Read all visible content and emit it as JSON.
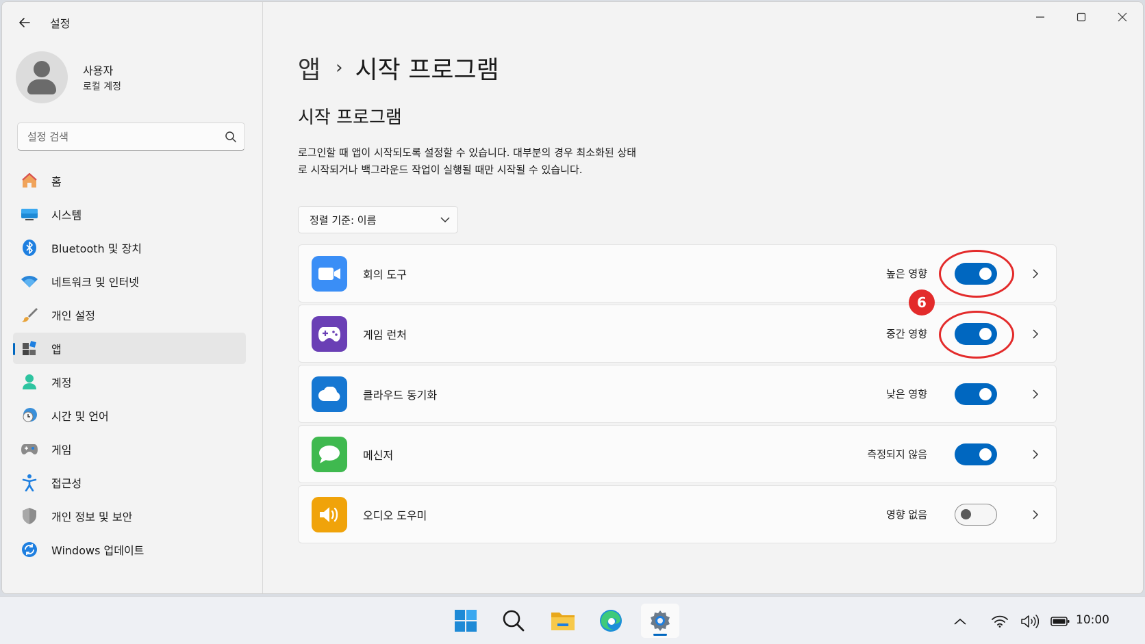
{
  "window": {
    "app_title": "설정",
    "controls": {
      "minimize": "─",
      "maximize": "☐",
      "close": "✕"
    }
  },
  "profile": {
    "name": "사용자",
    "account_type": "로컬 계정"
  },
  "search": {
    "placeholder": "설정 검색"
  },
  "sidebar": {
    "items": [
      {
        "label": "홈",
        "icon": "home-icon"
      },
      {
        "label": "시스템",
        "icon": "system-icon"
      },
      {
        "label": "Bluetooth 및 장치",
        "icon": "bluetooth-icon"
      },
      {
        "label": "네트워크 및 인터넷",
        "icon": "wifi-icon"
      },
      {
        "label": "개인 설정",
        "icon": "brush-icon"
      },
      {
        "label": "앱",
        "icon": "apps-icon",
        "active": true
      },
      {
        "label": "계정",
        "icon": "account-icon"
      },
      {
        "label": "시간 및 언어",
        "icon": "clock-globe-icon"
      },
      {
        "label": "게임",
        "icon": "gamepad-icon"
      },
      {
        "label": "접근성",
        "icon": "accessibility-icon"
      },
      {
        "label": "개인 정보 및 보안",
        "icon": "shield-icon"
      },
      {
        "label": "Windows 업데이트",
        "icon": "update-icon"
      }
    ]
  },
  "main": {
    "breadcrumb": {
      "parent": "앱",
      "separator": "›",
      "current": "시작 프로그램"
    },
    "section_title": "시작 프로그램",
    "description": "로그인할 때 앱이 시작되도록 설정할 수 있습니다. 대부분의 경우 최소화된 상태로 시작되거나 백그라운드 작업이 실행될 때만 시작될 수 있습니다.",
    "sort": {
      "label": "정렬 기준: 이름"
    },
    "apps": [
      {
        "name": "회의 도구",
        "impact": "높은 영향",
        "enabled": true,
        "icon": "video-camera-icon",
        "color": "#3a8ef6"
      },
      {
        "name": "게임 런처",
        "impact": "중간 영향",
        "enabled": true,
        "icon": "game-controller-icon",
        "color": "#6a3fb5"
      },
      {
        "name": "클라우드 동기화",
        "impact": "낮은 영향",
        "enabled": true,
        "icon": "cloud-icon",
        "color": "#1677d2"
      },
      {
        "name": "메신저",
        "impact": "측정되지 않음",
        "enabled": true,
        "icon": "chat-bubble-icon",
        "color": "#3fb94f"
      },
      {
        "name": "오디오 도우미",
        "impact": "영향 없음",
        "enabled": false,
        "icon": "speaker-icon",
        "color": "#f0a30a"
      }
    ],
    "annotation": {
      "step": "6",
      "color": "#e32b2b"
    }
  },
  "taskbar": {
    "apps": [
      "start-icon",
      "search-icon",
      "file-explorer-icon",
      "edge-icon",
      "settings-gear-icon"
    ],
    "clock": "10:00"
  },
  "colors": {
    "accent": "#0067c0"
  }
}
